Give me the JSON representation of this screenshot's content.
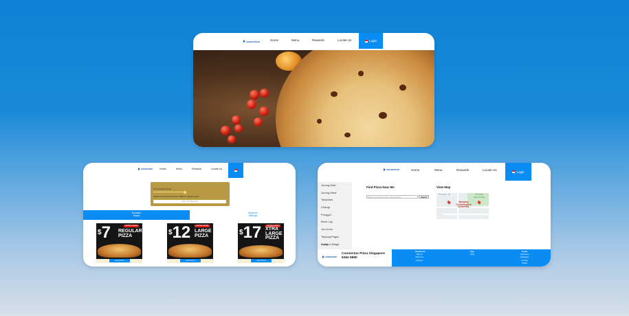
{
  "colors": {
    "accent": "#0a8cf5",
    "brand": "#1a62b8",
    "background": "#1a8ad8"
  },
  "top_card": {
    "brand": "connectus",
    "nav": [
      "Home",
      "Menu",
      "Rewards",
      "Locate Us"
    ],
    "login": "Login"
  },
  "left_card": {
    "brand": "connectus",
    "nav": [
      "Home",
      "Menu",
      "Rewards",
      "Locate Us"
    ],
    "promo": {
      "label": "$ Connectus Points",
      "note": "Add $ more points to 10 for 100% to redeem each",
      "button": "View Our Benefits"
    },
    "tabs": {
      "active_line1": "Exclusive",
      "active_line2": "Feasts",
      "other_line1": "Seasonal",
      "other_line2": "Offerings"
    },
    "deals": [
      {
        "price": "7",
        "line1": "REGULAR",
        "line2": "PIZZA",
        "line3": "",
        "tag": "LIMITED OFFER",
        "button": "Get Pizza"
      },
      {
        "price": "12",
        "line1": "LARGE",
        "line2": "PIZZA",
        "line3": "",
        "tag": "LIMITED OFFER",
        "button": "Get Pizza"
      },
      {
        "price": "17",
        "line1": "XTRA",
        "line2": "LARGE",
        "line3": "PIZZA",
        "tag": "LIMITED OFFER",
        "button": "Get Pizza"
      }
    ]
  },
  "right_card": {
    "brand": "connectus",
    "nav": [
      "Home",
      "Menu",
      "Rewards",
      "Locate Us"
    ],
    "login": "Login",
    "locations": [
      "Jurong East",
      "Jurong West",
      "Tampines",
      "Changi",
      "Punggol",
      "Boon Lay",
      "Joo Koon",
      "Tanjong Pagar",
      "Kranji",
      "Holland Village"
    ],
    "find_title": "Find Pizza Near Me",
    "find_placeholder": "Search for Postal Code or Street Name",
    "find_button": "Search",
    "view_title": "View Map",
    "map": {
      "view_larger": "View larger map",
      "place_line1": "Nanyang",
      "place_line2": "Technological",
      "place_line3": "University",
      "corner_line1": "NTU North",
      "corner_line2": "Spine Car Park"
    },
    "footer": {
      "brand": "connectus",
      "company": "Connectus Pizza Singapore",
      "phone": "6362 6890",
      "col1": {
        "head": "Restaurant",
        "items": [
          "Sign In",
          "About Us",
          "Careers"
        ]
      },
      "col2": {
        "head": "Help",
        "items": [
          "FAQ"
        ]
      },
      "col3": {
        "head": "Social",
        "items": [
          "Facebook",
          "Instagram",
          "Youtube",
          "TikTok"
        ]
      }
    }
  }
}
